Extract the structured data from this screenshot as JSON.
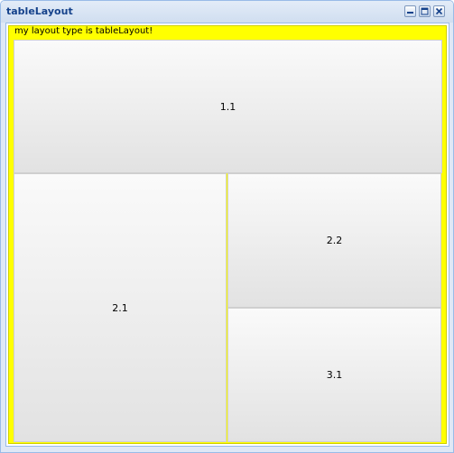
{
  "window": {
    "title": "tableLayout"
  },
  "tools": [
    "minimize-icon",
    "maximize-icon",
    "close-icon"
  ],
  "fieldset": {
    "legend": "my layout type is tableLayout!"
  },
  "cells": {
    "c11": "1.1",
    "c21": "2.1",
    "c22": "2.2",
    "c31": "3.1"
  },
  "colors": {
    "fieldset_bg": "#ffff00",
    "title": "#15428b",
    "window_bg": "#dfe8f6",
    "border": "#99bbe8"
  }
}
